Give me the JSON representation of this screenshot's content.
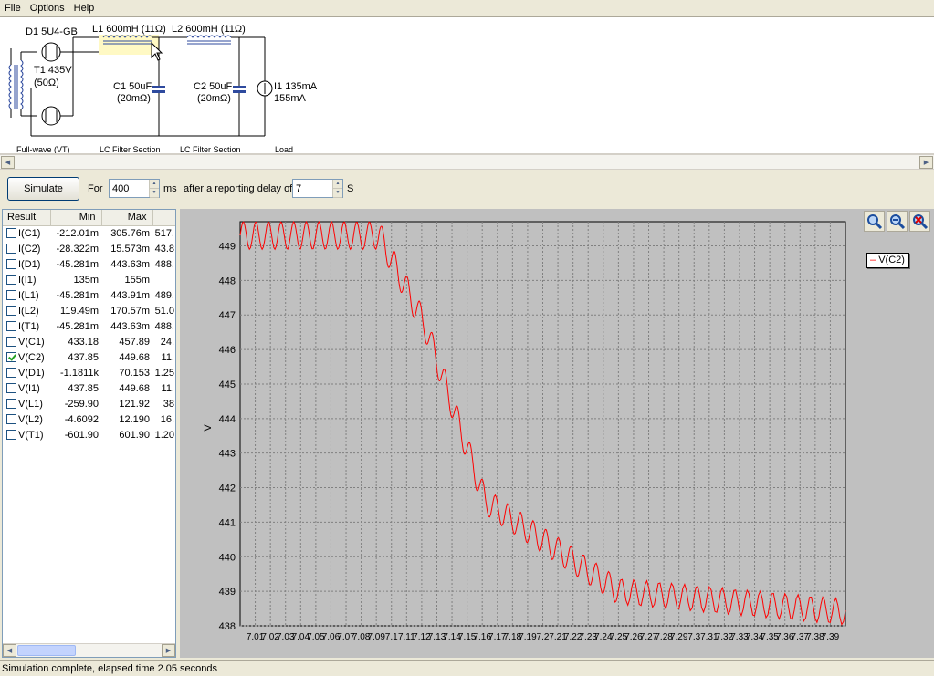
{
  "menu": [
    "File",
    "Options",
    "Help"
  ],
  "schematic": {
    "d1": "D1 5U4-GB",
    "t1_line1": "T1 435V",
    "t1_line2": "(50Ω)",
    "l1": "L1 600mH (11Ω)",
    "l2": "L2 600mH (11Ω)",
    "c1_line1": "C1 50uF",
    "c1_line2": "(20mΩ)",
    "c2_line1": "C2 50uF",
    "c2_line2": "(20mΩ)",
    "i1_line1": "I1 135mA",
    "i1_line2": "155mA",
    "section_fullwave": "Full-wave (VT)",
    "section_lc1": "LC Filter Section",
    "section_lc2": "LC Filter Section",
    "section_load": "Load"
  },
  "toolbar": {
    "simulate_label": "Simulate",
    "for_label": "For",
    "duration_value": "400",
    "ms_label": "ms",
    "delay_label": "after a reporting delay of",
    "delay_value": "7",
    "s_label": "S"
  },
  "results": {
    "columns": [
      "Result",
      "Min",
      "Max",
      ""
    ],
    "rows": [
      {
        "name": "I(C1)",
        "min": "-212.01m",
        "max": "305.76m",
        "extra": "517.",
        "checked": false
      },
      {
        "name": "I(C2)",
        "min": "-28.322m",
        "max": "15.573m",
        "extra": "43.8",
        "checked": false
      },
      {
        "name": "I(D1)",
        "min": "-45.281m",
        "max": "443.63m",
        "extra": "488.",
        "checked": false
      },
      {
        "name": "I(I1)",
        "min": "135m",
        "max": "155m",
        "extra": "",
        "checked": false
      },
      {
        "name": "I(L1)",
        "min": "-45.281m",
        "max": "443.91m",
        "extra": "489.",
        "checked": false
      },
      {
        "name": "I(L2)",
        "min": "119.49m",
        "max": "170.57m",
        "extra": "51.0",
        "checked": false
      },
      {
        "name": "I(T1)",
        "min": "-45.281m",
        "max": "443.63m",
        "extra": "488.",
        "checked": false
      },
      {
        "name": "V(C1)",
        "min": "433.18",
        "max": "457.89",
        "extra": "24.",
        "checked": false
      },
      {
        "name": "V(C2)",
        "min": "437.85",
        "max": "449.68",
        "extra": "11.",
        "checked": true
      },
      {
        "name": "V(D1)",
        "min": "-1.1811k",
        "max": "70.153",
        "extra": "1.25",
        "checked": false
      },
      {
        "name": "V(I1)",
        "min": "437.85",
        "max": "449.68",
        "extra": "11.",
        "checked": false
      },
      {
        "name": "V(L1)",
        "min": "-259.90",
        "max": "121.92",
        "extra": "38",
        "checked": false
      },
      {
        "name": "V(L2)",
        "min": "-4.6092",
        "max": "12.190",
        "extra": "16.",
        "checked": false
      },
      {
        "name": "V(T1)",
        "min": "-601.90",
        "max": "601.90",
        "extra": "1.20",
        "checked": false
      }
    ]
  },
  "chart_data": {
    "type": "line",
    "ylabel": "V",
    "ylim": [
      438,
      449.7
    ],
    "yticks": [
      449,
      448,
      447,
      446,
      445,
      444,
      443,
      442,
      441,
      440,
      439,
      438
    ],
    "xticks": [
      "7.01",
      "7.02",
      "7.03",
      "7.04",
      "7.05",
      "7.06",
      "7.07",
      "7.08",
      "7.09",
      "7.1",
      "7.11",
      "7.12",
      "7.13",
      "7.14",
      "7.15",
      "7.16",
      "7.17",
      "7.18",
      "7.19",
      "7.2",
      "7.21",
      "7.22",
      "7.23",
      "7.24",
      "7.25",
      "7.26",
      "7.27",
      "7.28",
      "7.29",
      "7.3",
      "7.31",
      "7.32",
      "7.33",
      "7.34",
      "7.35",
      "7.36",
      "7.37",
      "7.38",
      "7.39"
    ],
    "xlim": [
      7.0,
      7.4
    ],
    "grid": true,
    "legend_position": "right",
    "series": [
      {
        "name": "V(C2)",
        "color": "#ff0000",
        "segments": [
          {
            "x": [
              7.0,
              7.092
            ],
            "center": [
              449.3,
              449.3
            ],
            "ripple": 0.4
          },
          {
            "x": [
              7.092,
              7.122
            ],
            "center": [
              449.3,
              446.7
            ],
            "ripple": 0.4
          },
          {
            "x": [
              7.122,
              7.162
            ],
            "center": [
              446.7,
              441.6
            ],
            "ripple": 0.4
          },
          {
            "x": [
              7.162,
              7.25
            ],
            "center": [
              441.6,
              439.0
            ],
            "ripple": 0.38
          },
          {
            "x": [
              7.25,
              7.4
            ],
            "center": [
              439.0,
              438.4
            ],
            "ripple": 0.38
          }
        ],
        "ripple_period": 0.00833
      }
    ]
  },
  "zoom_icons": [
    "zoom-in-icon",
    "zoom-out-icon",
    "zoom-reset-icon"
  ],
  "status": "Simulation complete, elapsed time 2.05 seconds"
}
